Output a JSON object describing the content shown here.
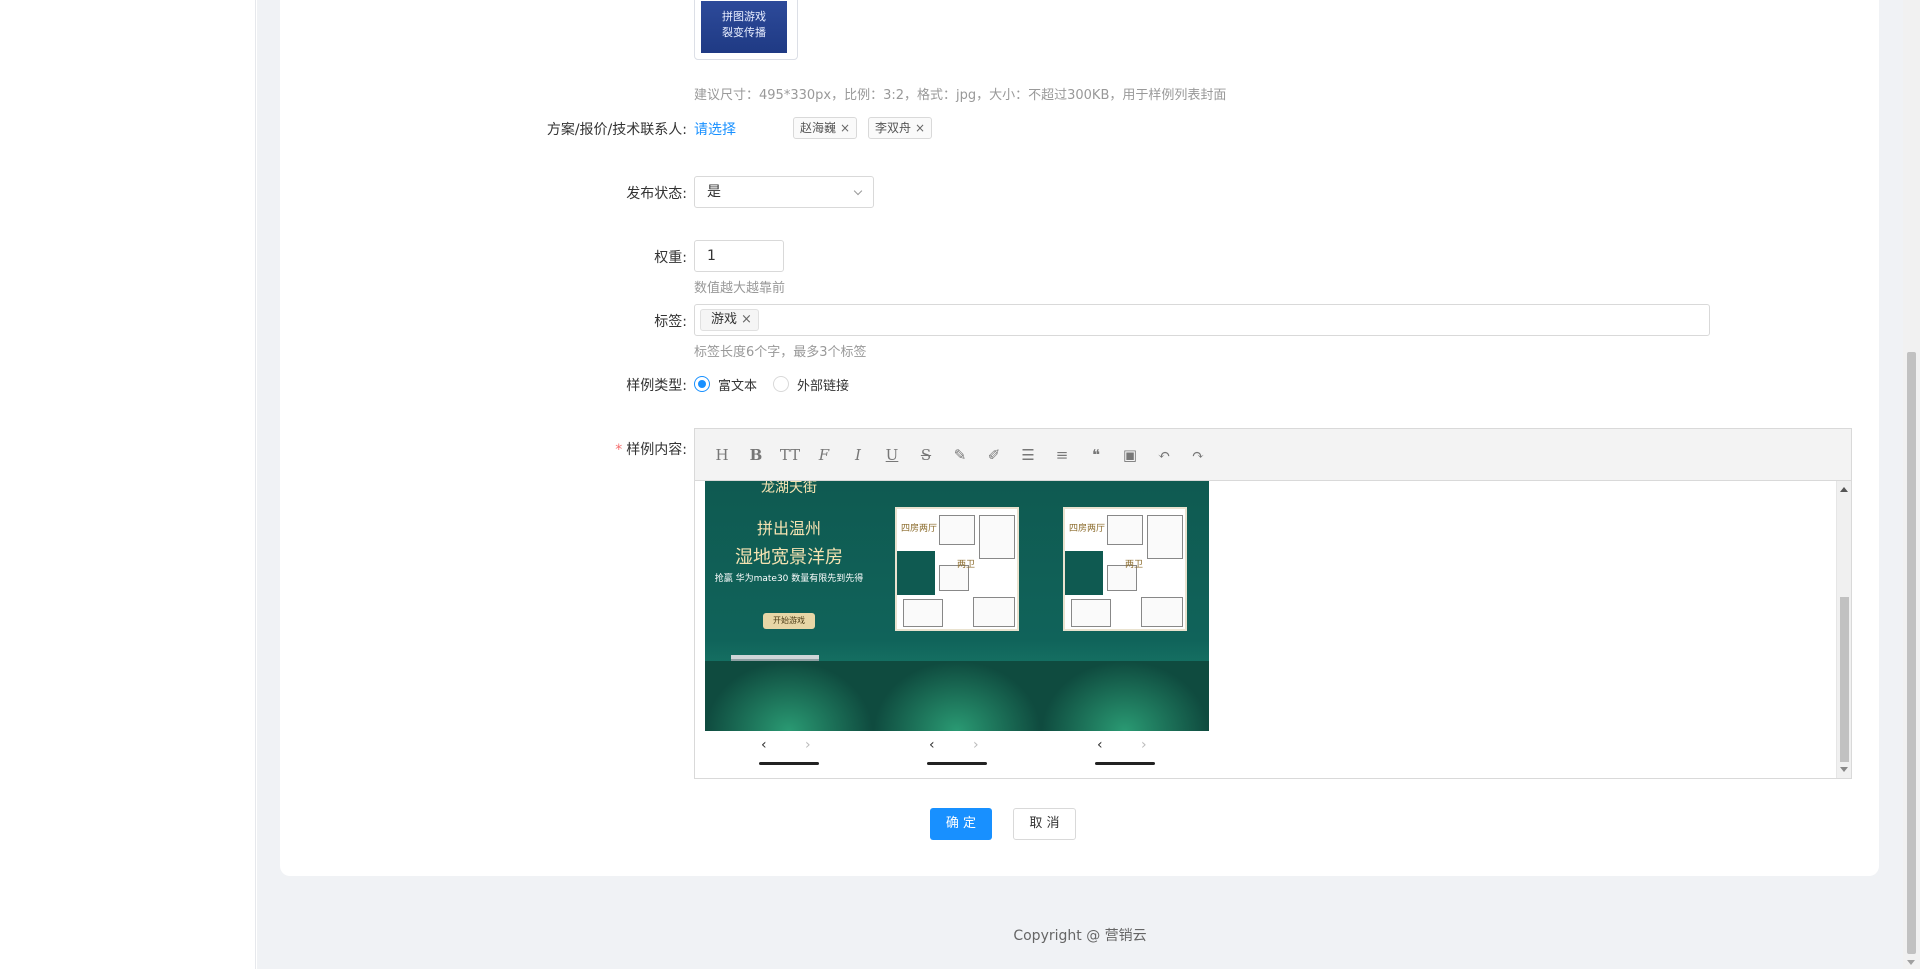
{
  "form": {
    "cover_hint": "建议尺寸：495*330px，比例：3:2，格式：jpg，大小：不超过300KB，用于样例列表封面",
    "cover_text_line1": "拼图游戏",
    "cover_text_line2": "裂变传播",
    "contact_label": "方案/报价/技术联系人:",
    "contact_select": "请选择",
    "contacts": [
      "赵海巍",
      "李双舟"
    ],
    "publish_label": "发布状态:",
    "publish_value": "是",
    "weight_label": "权重:",
    "weight_value": "1",
    "weight_hint": "数值越大越靠前",
    "tags_label": "标签:",
    "tag_value": "游戏",
    "tags_hint": "标签长度6个字，最多3个标签",
    "type_label": "样例类型:",
    "type_options": [
      "富文本",
      "外部链接"
    ],
    "type_selected": "富文本",
    "content_label": "样例内容:",
    "required_mark": "*"
  },
  "editor": {
    "toolbar_icons": [
      "heading-icon",
      "bold-icon",
      "font-size-icon",
      "font-family-icon",
      "italic-icon",
      "underline-icon",
      "strikethrough-icon",
      "highlight-icon",
      "brush-icon",
      "list-icon",
      "align-icon",
      "quote-icon",
      "image-icon",
      "undo-icon",
      "redo-icon"
    ],
    "toolbar_glyphs": [
      "H",
      "B",
      "TT",
      "F",
      "I",
      "U",
      "S",
      "✎",
      "✐",
      "☰",
      "≡",
      "❝",
      "▣",
      "↶",
      "↷"
    ],
    "phone1": {
      "brand": "龙湖天街",
      "line1": "拼出温州",
      "line2": "湿地宽景洋房",
      "sub": "抢赢 华为mate30 数量有限先到先得",
      "button": "开始游戏"
    },
    "plan_labels": [
      "四房两厅",
      "两卫"
    ]
  },
  "actions": {
    "confirm": "确 定",
    "cancel": "取 消"
  },
  "footer": {
    "copyright": "Copyright @ 营销云"
  },
  "colors": {
    "primary": "#1890ff",
    "required": "#f56c6c",
    "hint": "#999999"
  }
}
